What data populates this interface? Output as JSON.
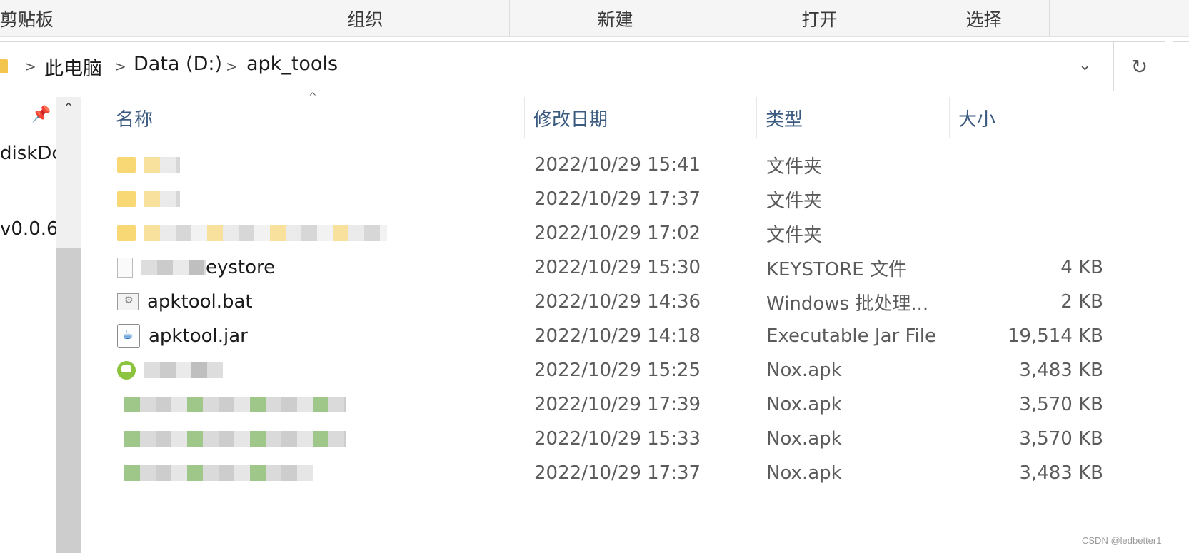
{
  "ribbon": {
    "groups": [
      "剪贴板",
      "组织",
      "新建",
      "打开",
      "选择"
    ]
  },
  "address_bar": {
    "crumbs": [
      "此电脑",
      "Data (D:)",
      "apk_tools"
    ],
    "separator": ">",
    "dropdown": "⌄",
    "refresh": "↻"
  },
  "nav_pane": {
    "items": [
      "diskDc",
      "v0.0.6"
    ],
    "pin": "📌",
    "scroll_up": "⌃"
  },
  "columns": {
    "name": "名称",
    "date": "修改日期",
    "type": "类型",
    "size": "大小",
    "sort_caret": "^"
  },
  "files": [
    {
      "name": "",
      "date": "2022/10/29 15:41",
      "type": "文件夹",
      "size": "",
      "icon": "folder-icon"
    },
    {
      "name": "",
      "date": "2022/10/29 17:37",
      "type": "文件夹",
      "size": "",
      "icon": "folder-icon"
    },
    {
      "name": "",
      "date": "2022/10/29 17:02",
      "type": "文件夹",
      "size": "",
      "icon": "folder-icon"
    },
    {
      "name": "eystore",
      "date": "2022/10/29 15:30",
      "type": "KEYSTORE 文件",
      "size": "4 KB",
      "icon": "keystore-file-icon"
    },
    {
      "name": "apktool.bat",
      "date": "2022/10/29 14:36",
      "type": "Windows 批处理...",
      "size": "2 KB",
      "icon": "batch-file-icon"
    },
    {
      "name": "apktool.jar",
      "date": "2022/10/29 14:18",
      "type": "Executable Jar File",
      "size": "19,514 KB",
      "icon": "java-jar-icon"
    },
    {
      "name": "",
      "date": "2022/10/29 15:25",
      "type": "Nox.apk",
      "size": "3,483 KB",
      "icon": "android-apk-icon"
    },
    {
      "name": "",
      "date": "2022/10/29 17:39",
      "type": "Nox.apk",
      "size": "3,570 KB",
      "icon": "android-apk-icon"
    },
    {
      "name": "",
      "date": "2022/10/29 15:33",
      "type": "Nox.apk",
      "size": "3,570 KB",
      "icon": "android-apk-icon"
    },
    {
      "name": "",
      "date": "2022/10/29 17:37",
      "type": "Nox.apk",
      "size": "3,483 KB",
      "icon": "android-apk-icon"
    }
  ],
  "watermark": "CSDN @ledbetter1"
}
